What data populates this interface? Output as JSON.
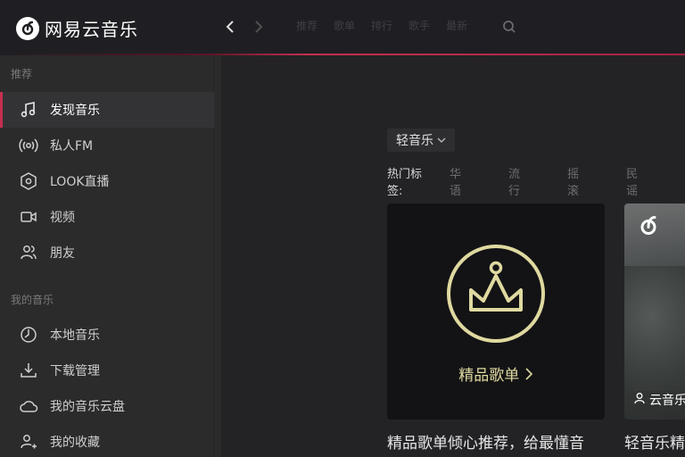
{
  "app": {
    "name": "网易云音乐"
  },
  "topbar": {
    "tabs": [
      "推荐",
      "歌单",
      "排行",
      "歌手",
      "最新"
    ]
  },
  "sidebar": {
    "section_recommend": "推荐",
    "items_recommend": [
      {
        "label": "发现音乐",
        "icon": "music-note-icon",
        "active": true
      },
      {
        "label": "私人FM",
        "icon": "radio-signal-icon"
      },
      {
        "label": "LOOK直播",
        "icon": "live-eye-icon"
      },
      {
        "label": "视频",
        "icon": "video-camera-icon"
      },
      {
        "label": "朋友",
        "icon": "friends-icon"
      }
    ],
    "section_my_music": "我的音乐",
    "items_my_music": [
      {
        "label": "本地音乐",
        "icon": "local-music-icon"
      },
      {
        "label": "下载管理",
        "icon": "download-icon"
      },
      {
        "label": "我的音乐云盘",
        "icon": "cloud-icon"
      },
      {
        "label": "我的收藏",
        "icon": "collection-icon"
      }
    ]
  },
  "main": {
    "category_button": "轻音乐",
    "hot_tags_label": "热门标签:",
    "hot_tags": [
      "华语",
      "流行",
      "摇滚",
      "民谣"
    ],
    "card1": {
      "label": "精品歌单",
      "title": "精品歌单倾心推荐，给最懂音"
    },
    "card2": {
      "creator": "云音乐",
      "title": "轻音乐精"
    }
  },
  "colors": {
    "accent": "#c62f4f",
    "crown": "#dfd9a0",
    "topbar_bg": "#1f1f23",
    "sidebar_bg": "#2b2b2b",
    "main_bg": "#232326"
  }
}
